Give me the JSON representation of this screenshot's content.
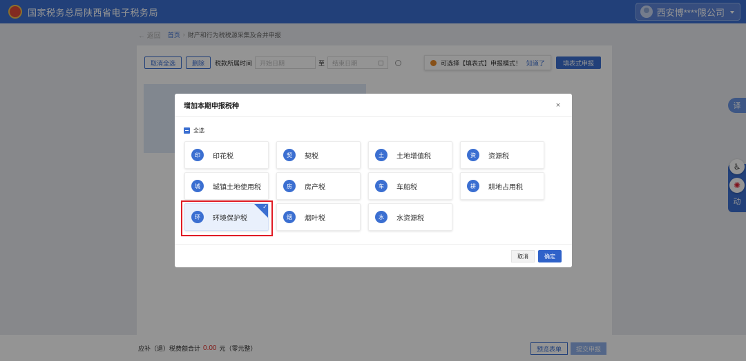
{
  "header": {
    "brand": "国家税务总局陕西省电子税务局",
    "user": "西安博****限公司"
  },
  "breadcrumb": {
    "back": "返回",
    "home": "首页",
    "separator": "›",
    "current": "财产和行为税税源采集及合并申报"
  },
  "toolbar": {
    "cancel_all": "取消全选",
    "delete": "删除",
    "period_label": "税款所属时间",
    "start_placeholder": "开始日期",
    "to": "至",
    "end_placeholder": "结束日期"
  },
  "notice": {
    "text": "可选择【填表式】申报模式！",
    "link": "知道了"
  },
  "form_mode_button": "填表式申报",
  "footer": {
    "total_label": "应补（退）税费额合计",
    "amount": "0.00",
    "unit": "元（零元整）",
    "preview": "预览表单",
    "submit": "提交申报"
  },
  "float": {
    "translate": "译",
    "interact": "动",
    "accessibility": "♿",
    "logo": "✺"
  },
  "modal": {
    "title": "增加本期申报税种",
    "close": "×",
    "select_all": "全选",
    "taxes": [
      {
        "label": "印花税",
        "icon": "stamp-icon",
        "glyph": "印",
        "selected": false
      },
      {
        "label": "契税",
        "icon": "deed-icon",
        "glyph": "契",
        "selected": false
      },
      {
        "label": "土地增值税",
        "icon": "land-value-icon",
        "glyph": "土",
        "selected": false
      },
      {
        "label": "资源税",
        "icon": "resource-icon",
        "glyph": "资",
        "selected": false
      },
      {
        "label": "城镇土地使用税",
        "icon": "urban-land-icon",
        "glyph": "城",
        "selected": false
      },
      {
        "label": "房产税",
        "icon": "property-icon",
        "glyph": "房",
        "selected": false
      },
      {
        "label": "车船税",
        "icon": "vehicle-icon",
        "glyph": "车",
        "selected": false
      },
      {
        "label": "耕地占用税",
        "icon": "farmland-icon",
        "glyph": "耕",
        "selected": false
      },
      {
        "label": "环境保护税",
        "icon": "environment-icon",
        "glyph": "环",
        "selected": true
      },
      {
        "label": "烟叶税",
        "icon": "tobacco-icon",
        "glyph": "烟",
        "selected": false
      },
      {
        "label": "水资源税",
        "icon": "water-icon",
        "glyph": "水",
        "selected": false
      }
    ],
    "cancel": "取消",
    "confirm": "确定"
  },
  "colors": {
    "brand_blue": "#3b6fd1",
    "highlight_red": "#e01b24"
  }
}
